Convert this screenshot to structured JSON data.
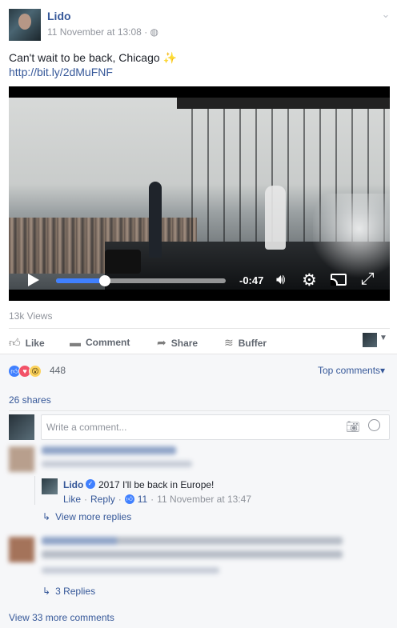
{
  "post": {
    "author": "Lido",
    "timestamp": "11 November at 13:08",
    "privacy_icon": "globe-icon",
    "text": "Can't wait to be back, Chicago ✨",
    "link": "http://bit.ly/2dMuFNF"
  },
  "video": {
    "progress_fraction": 0.29,
    "remaining": "-0:47",
    "views": "13k Views"
  },
  "actions": {
    "like": "Like",
    "comment": "Comment",
    "share": "Share",
    "buffer": "Buffer"
  },
  "reactions": {
    "icons": [
      "like",
      "love",
      "wow"
    ],
    "count": "448",
    "top_comments": "Top comments",
    "shares": "26 shares"
  },
  "composer": {
    "placeholder": "Write a comment..."
  },
  "reply": {
    "author": "Lido",
    "text": "2017 I'll be back in Europe!",
    "like": "Like",
    "reply": "Reply",
    "likes": "11",
    "timestamp": "11 November at 13:47"
  },
  "links": {
    "view_more_replies": "View more replies",
    "three_replies": "3 Replies",
    "view_more_comments": "View 33 more comments"
  },
  "colors": {
    "link": "#365899",
    "accent": "#4080ff",
    "love": "#f25268",
    "wow": "#fcd25b"
  }
}
